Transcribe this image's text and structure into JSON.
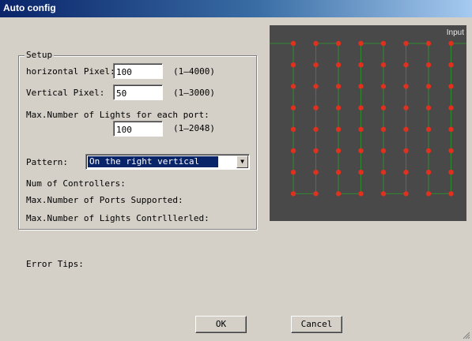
{
  "window": {
    "title": "Auto config"
  },
  "setup": {
    "legend": "Setup",
    "horizontal": {
      "label": "horizontal Pixel:",
      "value": "100",
      "range": "(1—4000)"
    },
    "vertical": {
      "label": "Vertical Pixel:",
      "value": "50",
      "range": "(1—3000)"
    },
    "max_lights": {
      "label": "Max.Number of Lights for each port:",
      "value": "100",
      "range": "(1—2048)"
    },
    "pattern": {
      "label": "Pattern:",
      "value": "On the right vertical"
    },
    "num_controllers_label": "Num of Controllers:",
    "max_ports_label": "Max.Number of Ports Supported:",
    "max_lights_ctrl_label": "Max.Number of Lights Contrlllerled:"
  },
  "preview": {
    "label": "Input",
    "columns": 8,
    "rows": 8,
    "colors": {
      "background": "#494949",
      "wire": "#2f8a2f",
      "led": "#e0301e"
    }
  },
  "error_tips_label": "Error Tips:",
  "buttons": {
    "ok": "OK",
    "cancel": "Cancel"
  }
}
